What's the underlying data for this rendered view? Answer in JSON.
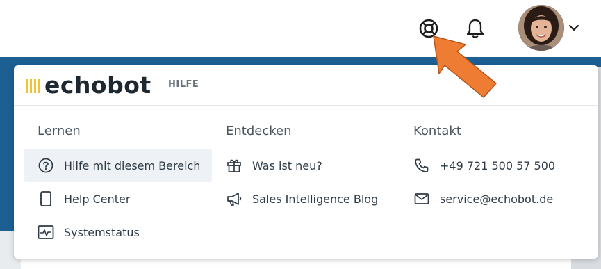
{
  "topbar": {
    "icons": [
      "lifebuoy-help-icon",
      "bell-icon",
      "chevron-down-icon"
    ]
  },
  "brand": {
    "name": "echobot",
    "section": "HILFE",
    "accent": "#f2c230"
  },
  "columns": [
    {
      "title": "Lernen",
      "items": [
        {
          "label": "Hilfe mit diesem Bereich",
          "icon": "question-circle-icon"
        },
        {
          "label": "Help Center",
          "icon": "book-icon"
        },
        {
          "label": "Systemstatus",
          "icon": "pulse-monitor-icon"
        }
      ]
    },
    {
      "title": "Entdecken",
      "items": [
        {
          "label": "Was ist neu?",
          "icon": "gift-icon"
        },
        {
          "label": "Sales Intelligence Blog",
          "icon": "megaphone-icon"
        }
      ]
    },
    {
      "title": "Kontakt",
      "items": [
        {
          "label": "+49 721 500 57 500",
          "icon": "phone-icon"
        },
        {
          "label": "service@echobot.de",
          "icon": "mail-icon"
        }
      ]
    }
  ],
  "colors": {
    "background_blue": "#1c5f93",
    "arrow_orange": "#ee7d33",
    "highlight": "#eef2f6"
  }
}
